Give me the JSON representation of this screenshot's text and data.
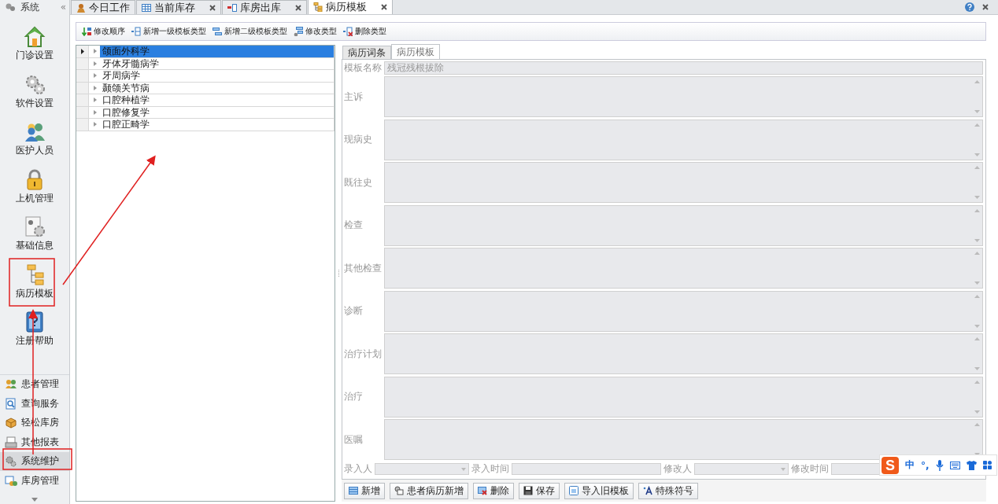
{
  "sidebar": {
    "title": "系统",
    "collapse": "«",
    "items": [
      {
        "label": "门诊设置"
      },
      {
        "label": "软件设置"
      },
      {
        "label": "医护人员"
      },
      {
        "label": "上机管理"
      },
      {
        "label": "基础信息"
      },
      {
        "label": "病历模板"
      },
      {
        "label": "注册帮助"
      }
    ],
    "groups": [
      {
        "label": "患者管理",
        "selected": false
      },
      {
        "label": "查询服务",
        "selected": false
      },
      {
        "label": "轻松库房",
        "selected": false
      },
      {
        "label": "其他报表",
        "selected": false
      },
      {
        "label": "系统维护",
        "selected": true
      },
      {
        "label": "库房管理",
        "selected": false
      }
    ]
  },
  "tabs": [
    {
      "label": "今日工作",
      "selected": false,
      "closable": false
    },
    {
      "label": "当前库存",
      "selected": false,
      "closable": true
    },
    {
      "label": "库房出库",
      "selected": false,
      "closable": true
    },
    {
      "label": "病历模板",
      "selected": true,
      "closable": true
    }
  ],
  "toolbar": [
    "修改顺序",
    "新增一级模板类型",
    "新增二级模板类型",
    "修改类型",
    "删除类型"
  ],
  "tree": {
    "rows": [
      {
        "label": "颌面外科学",
        "selected": true,
        "expanded": false
      },
      {
        "label": "牙体牙髓病学",
        "selected": false,
        "expanded": false
      },
      {
        "label": "牙周病学",
        "selected": false,
        "expanded": false
      },
      {
        "label": "颞颌关节病",
        "selected": false,
        "expanded": false
      },
      {
        "label": "口腔种植学",
        "selected": false,
        "expanded": false
      },
      {
        "label": "口腔修复学",
        "selected": false,
        "expanded": false
      },
      {
        "label": "口腔正畸学",
        "selected": false,
        "expanded": false
      }
    ]
  },
  "detail": {
    "tabs": [
      {
        "label": "病历词条",
        "selected": false
      },
      {
        "label": "病历模板",
        "selected": true
      }
    ],
    "disabled": true,
    "name_label": "模板名称",
    "name_value": "残冠残根拔除",
    "sections": [
      "主诉",
      "现病史",
      "既往史",
      "检查",
      "其他检查",
      "诊断",
      "治疗计划",
      "治疗",
      "医嘱"
    ],
    "footer": [
      {
        "label": "录入人",
        "kind": "combo"
      },
      {
        "label": "录入时间",
        "kind": "text"
      },
      {
        "label": "修改人",
        "kind": "combo"
      },
      {
        "label": "修改时间",
        "kind": "text"
      }
    ],
    "buttons": [
      "新增",
      "患者病历新增",
      "删除",
      "保存",
      "导入旧模板",
      "特殊符号"
    ]
  },
  "ime_bar": {
    "logo": "S",
    "mode": "中",
    "punct": "°,"
  }
}
